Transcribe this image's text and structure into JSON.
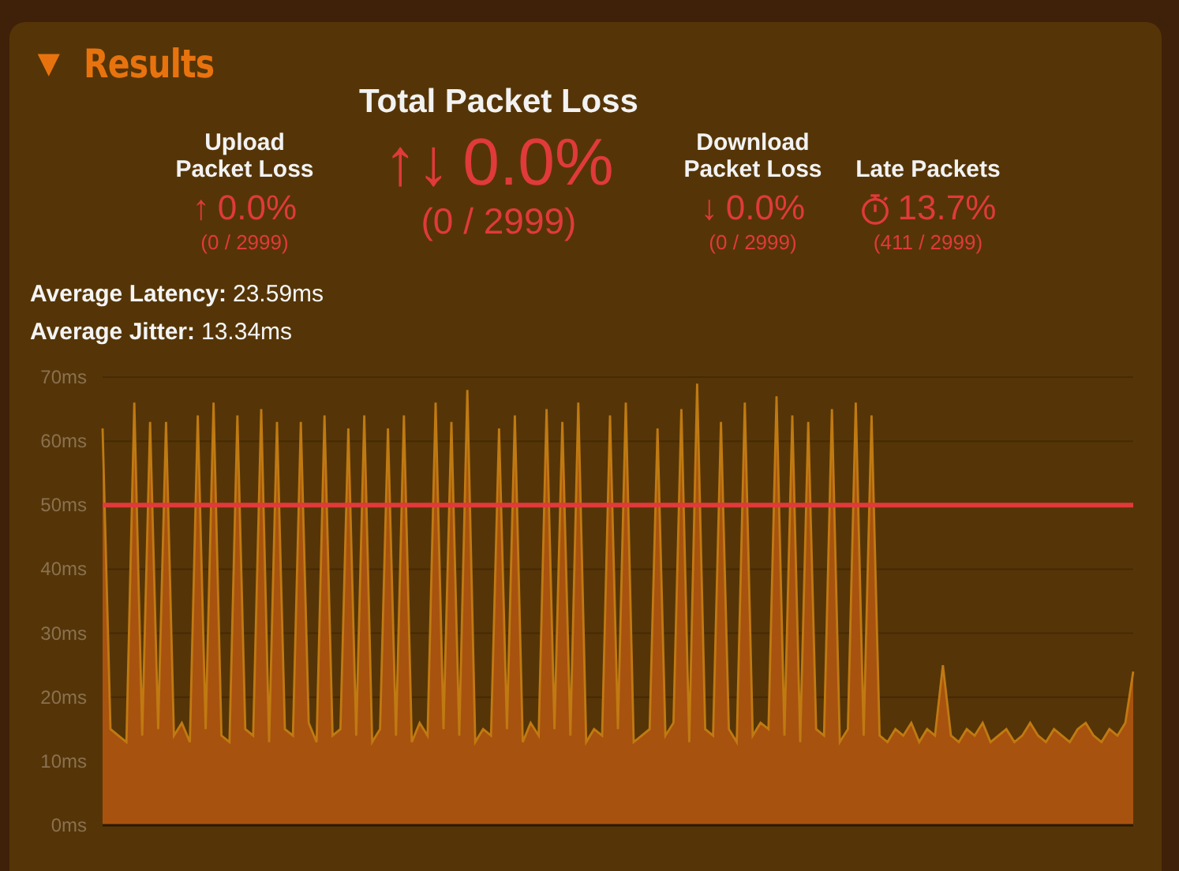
{
  "panel": {
    "toggle": "▼",
    "title": "Results",
    "expanded": true
  },
  "stats": [
    {
      "kind": "loss",
      "title": "Upload Packet Loss",
      "icon": "↑",
      "value": "0.0%",
      "count": "(0 / 2999)"
    },
    {
      "kind": "total",
      "title": "Total Packet Loss",
      "icon": "↑↓",
      "value": "0.0%",
      "count": "(0 / 2999)"
    },
    {
      "kind": "loss",
      "title": "Download Packet Loss",
      "icon": "↓",
      "value": "0.0%",
      "count": "(0 / 2999)"
    },
    {
      "kind": "late",
      "title": "Late Packets",
      "value": "13.7%",
      "count": "(411 / 2999)"
    }
  ],
  "averages": [
    {
      "label": "Average Latency:",
      "value": "23.59ms"
    },
    {
      "label": "Average Jitter:",
      "value": "13.34ms"
    }
  ],
  "chart_data": {
    "type": "area",
    "ylim": [
      0,
      70
    ],
    "yticks": [
      {
        "value": 0,
        "label": "0ms"
      },
      {
        "value": 10,
        "label": "10ms"
      },
      {
        "value": 20,
        "label": "20ms"
      },
      {
        "value": 30,
        "label": "30ms"
      },
      {
        "value": 40,
        "label": "40ms"
      },
      {
        "value": 50,
        "label": "50ms"
      },
      {
        "value": 60,
        "label": "60ms"
      },
      {
        "value": 70,
        "label": "70ms"
      }
    ],
    "grid": true,
    "ref_lines": [
      {
        "axis": "y",
        "value": 50,
        "color": "#e03a3a"
      }
    ],
    "series": [
      {
        "color": "#a8520f",
        "values": [
          62,
          15,
          14,
          13,
          66,
          14,
          63,
          15,
          63,
          14,
          16,
          13,
          64,
          15,
          66,
          14,
          13,
          64,
          15,
          14,
          65,
          13,
          63,
          15,
          14,
          63,
          16,
          13,
          64,
          14,
          15,
          62,
          14,
          64,
          13,
          15,
          62,
          14,
          64,
          13,
          16,
          14,
          66,
          15,
          63,
          14,
          68,
          13,
          15,
          14,
          62,
          15,
          64,
          13,
          16,
          14,
          65,
          15,
          63,
          14,
          66,
          13,
          15,
          14,
          64,
          15,
          66,
          13,
          14,
          15,
          62,
          14,
          16,
          65,
          13,
          69,
          15,
          14,
          63,
          15,
          13,
          66,
          14,
          16,
          15,
          67,
          14,
          64,
          13,
          63,
          15,
          14,
          65,
          13,
          15,
          66,
          14,
          64,
          14,
          13,
          15,
          14,
          16,
          13,
          15,
          14,
          25,
          14,
          13,
          15,
          14,
          16,
          13,
          14,
          15,
          13,
          14,
          16,
          14,
          13,
          15,
          14,
          13,
          15,
          16,
          14,
          13,
          15,
          14,
          16,
          24
        ]
      }
    ]
  }
}
